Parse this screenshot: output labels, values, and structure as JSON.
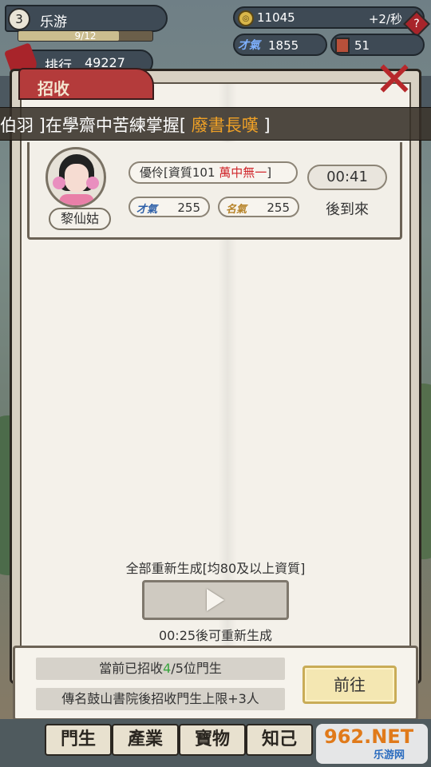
{
  "player": {
    "level": "3",
    "name": "乐游",
    "xp_text": "9/12",
    "xp_progress": 0.75,
    "rank_label": "排行",
    "rank_value": "49227"
  },
  "resources": {
    "coins": "11045",
    "coin_rate": "+2/秒",
    "help_label": "?",
    "talent_tag": "才氣",
    "talent_value": "1855",
    "books_value": "51"
  },
  "panel": {
    "tab_label": "招收",
    "close_label": "✕"
  },
  "announcement": {
    "prefix": "伯羽 ]在學齋中苦練掌握[ ",
    "highlight": "廢書長嘆",
    "suffix": " ]"
  },
  "student": {
    "name": "黎仙姑",
    "quality_prefix": "優伶[資質101 ",
    "quality_highlight": "萬中無一",
    "quality_suffix": "]",
    "stat1_tag": "才氣",
    "stat1_value": "255",
    "stat2_tag": "名氣",
    "stat2_value": "255",
    "timer": "00:41",
    "status": "後到來"
  },
  "regenerate": {
    "title": "全部重新生成[均80及以上資質]",
    "timer_text": "00:25後可重新生成"
  },
  "bottom_info": {
    "recruited_prefix": "當前已招收",
    "recruited_count": "4",
    "recruited_suffix": "/5位門生",
    "tip": "傳名鼓山書院後招收門生上限+3人",
    "goto_label": "前往"
  },
  "nav": {
    "tabs": [
      "門生",
      "產業",
      "寶物",
      "知己"
    ]
  },
  "watermark": {
    "main": "962.NET",
    "sub": "乐游网"
  },
  "colors": {
    "highlight_orange": "#f0a126",
    "quality_red": "#d0262b",
    "count_green": "#37a53d",
    "close_red": "#b7282b"
  }
}
